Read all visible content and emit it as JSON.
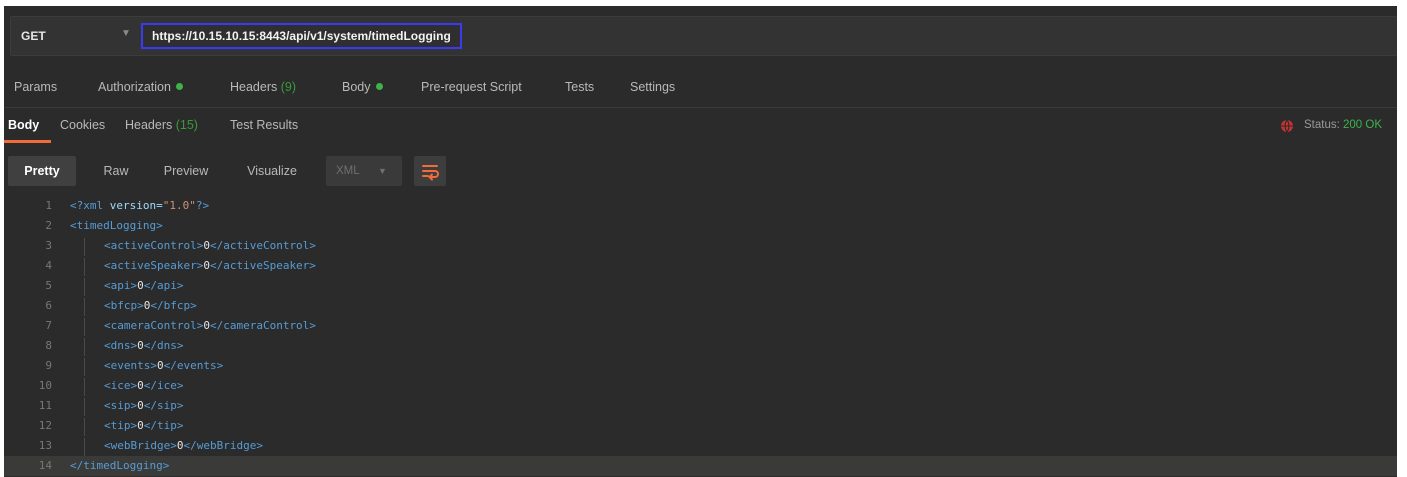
{
  "request": {
    "method": "GET",
    "url": "https://10.15.10.15:8443/api/v1/system/timedLogging"
  },
  "request_tabs": [
    {
      "label": "Params"
    },
    {
      "label": "Authorization"
    },
    {
      "label": "Headers",
      "count": "(9)"
    },
    {
      "label": "Body"
    },
    {
      "label": "Pre-request Script"
    },
    {
      "label": "Tests"
    },
    {
      "label": "Settings"
    }
  ],
  "response_tabs": [
    {
      "label": "Body"
    },
    {
      "label": "Cookies"
    },
    {
      "label": "Headers",
      "count": "(15)"
    },
    {
      "label": "Test Results"
    }
  ],
  "status": {
    "label": "Status:",
    "value": "200 OK"
  },
  "view_modes": [
    "Pretty",
    "Raw",
    "Preview",
    "Visualize"
  ],
  "language": "XML",
  "code": {
    "line_numbers": [
      "1",
      "2",
      "3",
      "4",
      "5",
      "6",
      "7",
      "8",
      "9",
      "10",
      "11",
      "12",
      "13",
      "14"
    ],
    "lines": [
      "<?xml version=\"1.0\"?>",
      "<timedLogging>",
      "<activeControl>0</activeControl>",
      "<activeSpeaker>0</activeSpeaker>",
      "<api>0</api>",
      "<bfcp>0</bfcp>",
      "<cameraControl>0</cameraControl>",
      "<dns>0</dns>",
      "<events>0</events>",
      "<ice>0</ice>",
      "<sip>0</sip>",
      "<tip>0</tip>",
      "<webBridge>0</webBridge>",
      "</timedLogging>"
    ]
  },
  "colors": {
    "accent": "#f26b3a",
    "status_ok": "#3cb44a",
    "url_highlight": "#3a3af0"
  },
  "icons": {
    "method_dropdown": "chevron-down-icon",
    "status": "globe-icon",
    "wrap": "wrap-lines-icon"
  }
}
